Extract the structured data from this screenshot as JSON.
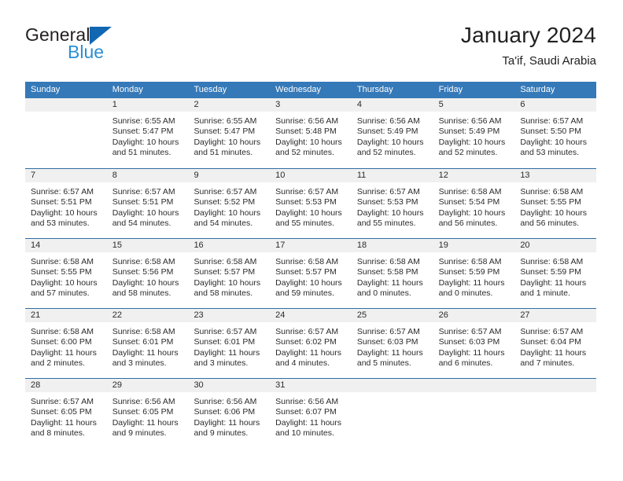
{
  "brand": {
    "name_primary": "General",
    "name_secondary": "Blue",
    "logo_icon": "triangle-logo-icon"
  },
  "header": {
    "title": "January 2024",
    "subtitle": "Ta'if, Saudi Arabia"
  },
  "colors": {
    "header_blue": "#3579b8",
    "row_border_blue": "#2f6ea5",
    "day_band_gray": "#f0f0f0",
    "brand_blue": "#2a8fd4",
    "logo_blue": "#1267b2",
    "text": "#2b2b2b"
  },
  "calendar": {
    "weekdays": [
      "Sunday",
      "Monday",
      "Tuesday",
      "Wednesday",
      "Thursday",
      "Friday",
      "Saturday"
    ],
    "weeks": [
      [
        {
          "day": "",
          "lines": []
        },
        {
          "day": "1",
          "lines": [
            "Sunrise: 6:55 AM",
            "Sunset: 5:47 PM",
            "Daylight: 10 hours",
            "and 51 minutes."
          ]
        },
        {
          "day": "2",
          "lines": [
            "Sunrise: 6:55 AM",
            "Sunset: 5:47 PM",
            "Daylight: 10 hours",
            "and 51 minutes."
          ]
        },
        {
          "day": "3",
          "lines": [
            "Sunrise: 6:56 AM",
            "Sunset: 5:48 PM",
            "Daylight: 10 hours",
            "and 52 minutes."
          ]
        },
        {
          "day": "4",
          "lines": [
            "Sunrise: 6:56 AM",
            "Sunset: 5:49 PM",
            "Daylight: 10 hours",
            "and 52 minutes."
          ]
        },
        {
          "day": "5",
          "lines": [
            "Sunrise: 6:56 AM",
            "Sunset: 5:49 PM",
            "Daylight: 10 hours",
            "and 52 minutes."
          ]
        },
        {
          "day": "6",
          "lines": [
            "Sunrise: 6:57 AM",
            "Sunset: 5:50 PM",
            "Daylight: 10 hours",
            "and 53 minutes."
          ]
        }
      ],
      [
        {
          "day": "7",
          "lines": [
            "Sunrise: 6:57 AM",
            "Sunset: 5:51 PM",
            "Daylight: 10 hours",
            "and 53 minutes."
          ]
        },
        {
          "day": "8",
          "lines": [
            "Sunrise: 6:57 AM",
            "Sunset: 5:51 PM",
            "Daylight: 10 hours",
            "and 54 minutes."
          ]
        },
        {
          "day": "9",
          "lines": [
            "Sunrise: 6:57 AM",
            "Sunset: 5:52 PM",
            "Daylight: 10 hours",
            "and 54 minutes."
          ]
        },
        {
          "day": "10",
          "lines": [
            "Sunrise: 6:57 AM",
            "Sunset: 5:53 PM",
            "Daylight: 10 hours",
            "and 55 minutes."
          ]
        },
        {
          "day": "11",
          "lines": [
            "Sunrise: 6:57 AM",
            "Sunset: 5:53 PM",
            "Daylight: 10 hours",
            "and 55 minutes."
          ]
        },
        {
          "day": "12",
          "lines": [
            "Sunrise: 6:58 AM",
            "Sunset: 5:54 PM",
            "Daylight: 10 hours",
            "and 56 minutes."
          ]
        },
        {
          "day": "13",
          "lines": [
            "Sunrise: 6:58 AM",
            "Sunset: 5:55 PM",
            "Daylight: 10 hours",
            "and 56 minutes."
          ]
        }
      ],
      [
        {
          "day": "14",
          "lines": [
            "Sunrise: 6:58 AM",
            "Sunset: 5:55 PM",
            "Daylight: 10 hours",
            "and 57 minutes."
          ]
        },
        {
          "day": "15",
          "lines": [
            "Sunrise: 6:58 AM",
            "Sunset: 5:56 PM",
            "Daylight: 10 hours",
            "and 58 minutes."
          ]
        },
        {
          "day": "16",
          "lines": [
            "Sunrise: 6:58 AM",
            "Sunset: 5:57 PM",
            "Daylight: 10 hours",
            "and 58 minutes."
          ]
        },
        {
          "day": "17",
          "lines": [
            "Sunrise: 6:58 AM",
            "Sunset: 5:57 PM",
            "Daylight: 10 hours",
            "and 59 minutes."
          ]
        },
        {
          "day": "18",
          "lines": [
            "Sunrise: 6:58 AM",
            "Sunset: 5:58 PM",
            "Daylight: 11 hours",
            "and 0 minutes."
          ]
        },
        {
          "day": "19",
          "lines": [
            "Sunrise: 6:58 AM",
            "Sunset: 5:59 PM",
            "Daylight: 11 hours",
            "and 0 minutes."
          ]
        },
        {
          "day": "20",
          "lines": [
            "Sunrise: 6:58 AM",
            "Sunset: 5:59 PM",
            "Daylight: 11 hours",
            "and 1 minute."
          ]
        }
      ],
      [
        {
          "day": "21",
          "lines": [
            "Sunrise: 6:58 AM",
            "Sunset: 6:00 PM",
            "Daylight: 11 hours",
            "and 2 minutes."
          ]
        },
        {
          "day": "22",
          "lines": [
            "Sunrise: 6:58 AM",
            "Sunset: 6:01 PM",
            "Daylight: 11 hours",
            "and 3 minutes."
          ]
        },
        {
          "day": "23",
          "lines": [
            "Sunrise: 6:57 AM",
            "Sunset: 6:01 PM",
            "Daylight: 11 hours",
            "and 3 minutes."
          ]
        },
        {
          "day": "24",
          "lines": [
            "Sunrise: 6:57 AM",
            "Sunset: 6:02 PM",
            "Daylight: 11 hours",
            "and 4 minutes."
          ]
        },
        {
          "day": "25",
          "lines": [
            "Sunrise: 6:57 AM",
            "Sunset: 6:03 PM",
            "Daylight: 11 hours",
            "and 5 minutes."
          ]
        },
        {
          "day": "26",
          "lines": [
            "Sunrise: 6:57 AM",
            "Sunset: 6:03 PM",
            "Daylight: 11 hours",
            "and 6 minutes."
          ]
        },
        {
          "day": "27",
          "lines": [
            "Sunrise: 6:57 AM",
            "Sunset: 6:04 PM",
            "Daylight: 11 hours",
            "and 7 minutes."
          ]
        }
      ],
      [
        {
          "day": "28",
          "lines": [
            "Sunrise: 6:57 AM",
            "Sunset: 6:05 PM",
            "Daylight: 11 hours",
            "and 8 minutes."
          ]
        },
        {
          "day": "29",
          "lines": [
            "Sunrise: 6:56 AM",
            "Sunset: 6:05 PM",
            "Daylight: 11 hours",
            "and 9 minutes."
          ]
        },
        {
          "day": "30",
          "lines": [
            "Sunrise: 6:56 AM",
            "Sunset: 6:06 PM",
            "Daylight: 11 hours",
            "and 9 minutes."
          ]
        },
        {
          "day": "31",
          "lines": [
            "Sunrise: 6:56 AM",
            "Sunset: 6:07 PM",
            "Daylight: 11 hours",
            "and 10 minutes."
          ]
        },
        {
          "day": "",
          "lines": []
        },
        {
          "day": "",
          "lines": []
        },
        {
          "day": "",
          "lines": []
        }
      ]
    ]
  }
}
